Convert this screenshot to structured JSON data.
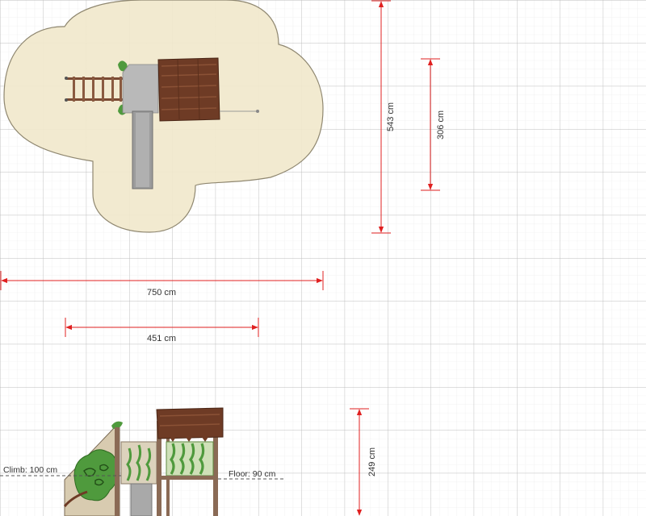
{
  "plan": {
    "safety_zone_color": "#f1e8cc",
    "safety_zone_stroke": "#8f8770",
    "roof_color": "#6e3b25",
    "deck_color": "#b9b9b9",
    "slide_color": "#9c9c9c",
    "ladder_color": "#7a4a33"
  },
  "dimensions": {
    "overall_width": "750 cm",
    "equipment_width": "451 cm",
    "overall_depth": "543 cm",
    "equipment_depth": "306 cm",
    "equipment_height": "249 cm",
    "arrow_color": "#e02020"
  },
  "elevation": {
    "climb_label": "Climb: 100 cm",
    "floor_label": "Floor: 90 cm",
    "foliage_color": "#4f9a3d",
    "post_color": "#8a6a55"
  },
  "grid": {
    "minor_color": "#e6e6e6",
    "major_color": "#bcbcbc"
  }
}
